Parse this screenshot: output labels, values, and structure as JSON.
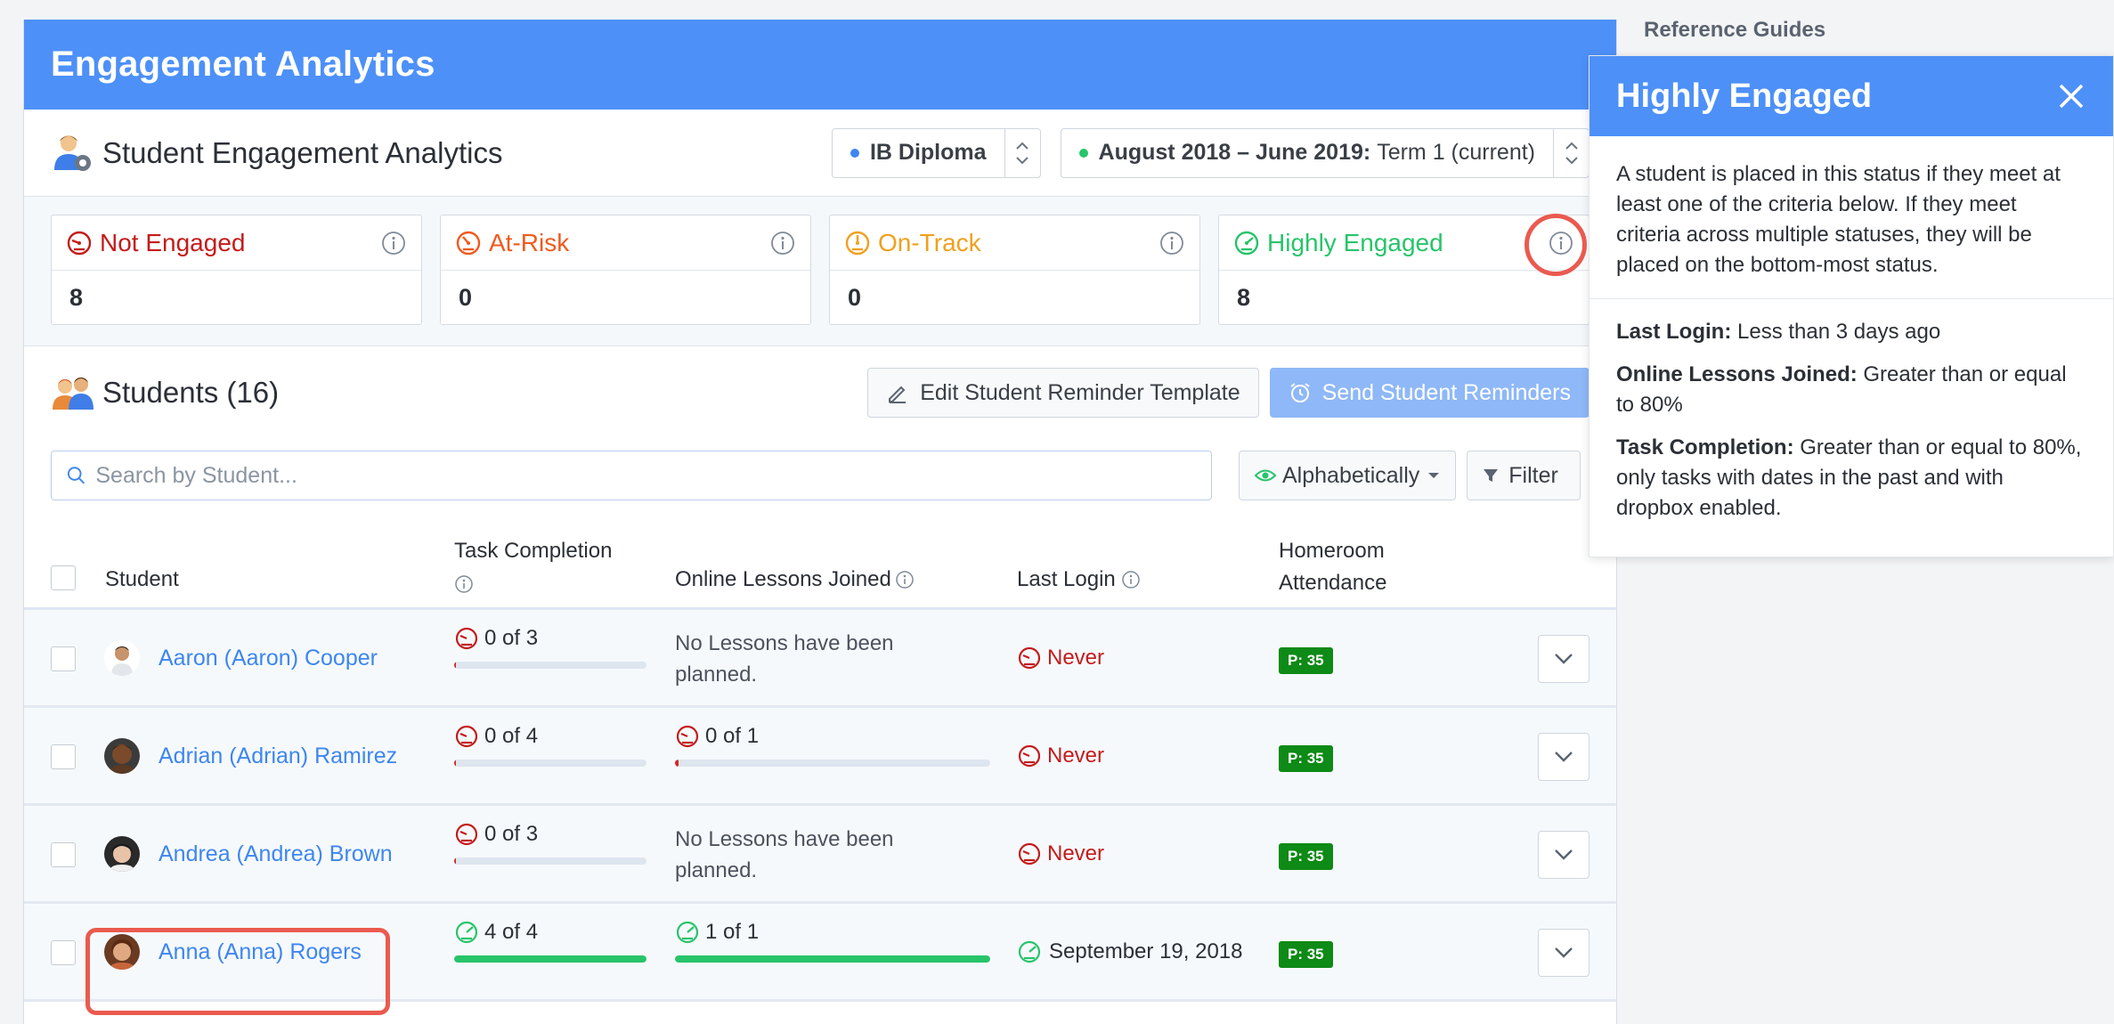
{
  "app": {
    "title": "Engagement Analytics"
  },
  "subheader": {
    "title": "Student Engagement Analytics",
    "program_selector": "IB Diploma",
    "term_selector_bold": "August 2018 – June 2019:",
    "term_selector_rest": "Term 1 (current)"
  },
  "status_cards": [
    {
      "label": "Not Engaged",
      "count": "8",
      "color": "#c41b1b"
    },
    {
      "label": "At-Risk",
      "count": "0",
      "color": "#f05a1e"
    },
    {
      "label": "On-Track",
      "count": "0",
      "color": "#f0a01e"
    },
    {
      "label": "Highly Engaged",
      "count": "8",
      "color": "#27c46a"
    }
  ],
  "students": {
    "title": "Students (16)",
    "edit_button": "Edit Student Reminder Template",
    "send_button": "Send Student Reminders",
    "search_placeholder": "Search by Student...",
    "sort_label": "Alphabetically",
    "filter_label": "Filter"
  },
  "table": {
    "col_student": "Student",
    "col_task": "Task Completion",
    "col_lessons": "Online Lessons Joined",
    "col_login": "Last Login",
    "col_attendance_1": "Homeroom",
    "col_attendance_2": "Attendance",
    "rows": [
      {
        "name": "Aaron (Aaron) Cooper",
        "task": "0 of 3",
        "task_progress": 0.0,
        "lessons_none_1": "No Lessons have been",
        "lessons_none_2": "planned.",
        "login": "Never",
        "attendance": "P: 35"
      },
      {
        "name": "Adrian (Adrian) Ramirez",
        "task": "0 of 4",
        "task_progress": 0.0,
        "lessons": "0 of 1",
        "lessons_progress": 0.0,
        "login": "Never",
        "attendance": "P: 35"
      },
      {
        "name": "Andrea (Andrea) Brown",
        "task": "0 of 3",
        "task_progress": 0.0,
        "lessons_none_1": "No Lessons have been",
        "lessons_none_2": "planned.",
        "login": "Never",
        "attendance": "P: 35"
      },
      {
        "name": "Anna (Anna) Rogers",
        "task": "4 of 4",
        "task_progress": 1.0,
        "lessons": "1 of 1",
        "lessons_progress": 1.0,
        "login": "September 19, 2018",
        "attendance": "P: 35"
      }
    ]
  },
  "sidebar": {
    "reference_title": "Reference Guides"
  },
  "popover": {
    "title": "Highly Engaged",
    "description": "A student is placed in this status if they meet at least one of the criteria below. If they meet criteria across multiple statuses, they will be placed on the bottom-most status.",
    "criteria": [
      {
        "label": "Last Login:",
        "text": " Less than 3 days ago"
      },
      {
        "label": "Online Lessons Joined:",
        "text": " Greater than or equal to 80%"
      },
      {
        "label": "Task Completion:",
        "text": " Greater than or equal to 80%, only tasks with dates in the past and with dropbox enabled."
      }
    ]
  }
}
